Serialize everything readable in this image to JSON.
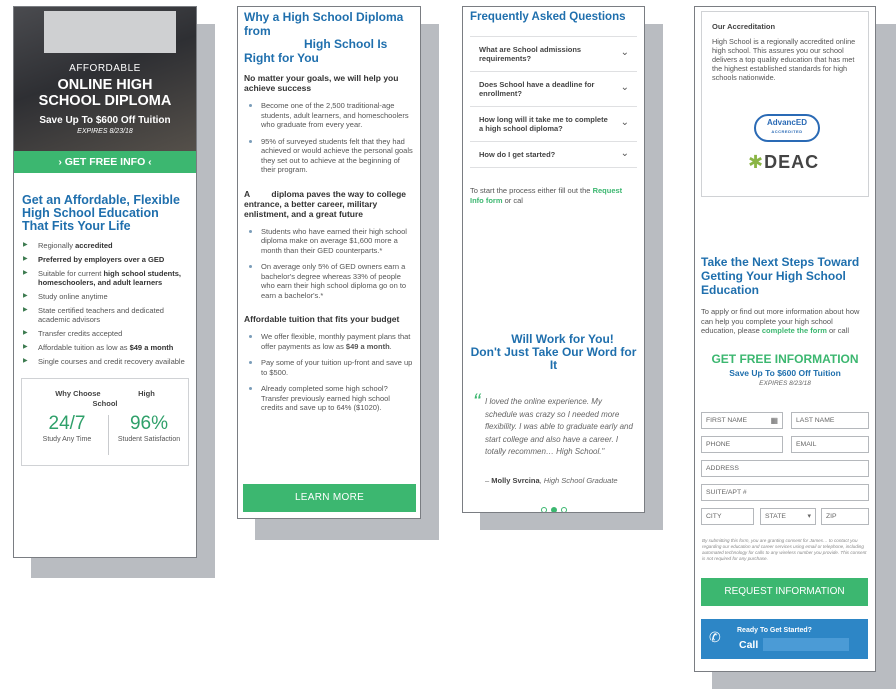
{
  "panel1": {
    "kicker": "AFFORDABLE",
    "headline_1": "ONLINE HIGH",
    "headline_2": "SCHOOL DIPLOMA",
    "offer": "Save Up To $600 Off Tuition",
    "expires": "EXPIRES 8/23/18",
    "cta": "› GET FREE INFO ‹",
    "title": "Get an Affordable, Flexible High School Education That Fits Your Life",
    "benefits": [
      {
        "pre": "Regionally ",
        "bold": "accredited",
        "post": ""
      },
      {
        "pre": "",
        "bold": "Preferred by employers over a GED",
        "post": ""
      },
      {
        "pre": "Suitable for current ",
        "bold": "high school students, homeschoolers, and adult learners",
        "post": ""
      },
      {
        "pre": "Study online anytime",
        "bold": "",
        "post": ""
      },
      {
        "pre": "State certified teachers and dedicated academic advisors",
        "bold": "",
        "post": ""
      },
      {
        "pre": "Transfer credits accepted",
        "bold": "",
        "post": ""
      },
      {
        "pre": "Affordable tuition as low as ",
        "bold": "$49 a month",
        "post": ""
      },
      {
        "pre": "Single courses and credit recovery available",
        "bold": "",
        "post": ""
      }
    ],
    "why_title_1": "Why Choose",
    "why_title_2": "High",
    "why_title_3": "School",
    "stats": [
      {
        "num": "24/7",
        "label": "Study Any Time"
      },
      {
        "num": "96%",
        "label": "Student Satisfaction"
      }
    ]
  },
  "panel2": {
    "title_1": "Why a High School Diploma from",
    "title_2": "High School Is",
    "title_3": "Right for You",
    "h1": "No matter your goals, we will help you achieve success",
    "list1": [
      "Become one of the 2,500 traditional-age students, adult learners, and homeschoolers who graduate from every year.",
      "95% of surveyed students felt that they had achieved or would achieve the personal goals they set out to achieve at the beginning of their program."
    ],
    "h2_a": "A",
    "h2_b": "diploma paves the way to college entrance, a better career, military enlistment, and a great future",
    "list2": [
      "Students who have earned their high school diploma make on average $1,600 more a month than their GED counterparts.*",
      "On average only 5% of GED owners earn a bachelor's degree whereas 33% of people who earn their high school diploma go on to earn a bachelor's.*"
    ],
    "h3": "Affordable tuition that fits your budget",
    "list3_0_pre": "We offer flexible, monthly payment plans that offer payments as low as ",
    "list3_0_bold": "$49 a month",
    "list3_0_post": ".",
    "list3": [
      "Pay some of your tuition up-front and save up to $500.",
      "Already completed some high school? Transfer previously earned high school credits and save up to 64% ($1020)."
    ],
    "cta": "LEARN MORE"
  },
  "panel3": {
    "title": "Frequently Asked Questions",
    "faqs": [
      "What are School admissions requirements?",
      "Does School have a deadline for enrollment?",
      "How long will it take me to complete a high school diploma?",
      "How do I get started?"
    ],
    "start_pre": "To start the process either fill out the ",
    "start_link": "Request Info form",
    "start_post": " or cal",
    "quote_title_1": "Will Work for You!",
    "quote_title_2": "Don't Just Take Our Word for It",
    "quote": "I loved the online experience. My schedule was crazy so I needed more flexibility. I was able to graduate early and start college and also have a career. I totally recommen… High School.\"",
    "quote_author": "Molly Svrcina",
    "quote_author_role": ", High School Graduate"
  },
  "panel4": {
    "accred_title": "Our Accreditation",
    "accred_text": "High School is a regionally accredited online high school. This assures you our school delivers a top quality education that has met the highest established standards for high schools nationwide.",
    "logo_advanced": "AdvancED",
    "logo_advanced_sub": "ACCREDITED",
    "logo_deac": "DEAC",
    "title": "Take the Next Steps Toward Getting Your High School Education",
    "apply_pre": "To apply or find out more information about how can help you complete your high school education, please ",
    "apply_link": "complete the form",
    "apply_post": " or call",
    "form_title": "GET FREE INFORMATION",
    "form_offer": "Save Up To $600 Off Tuition",
    "form_expires": "EXPIRES 8/23/18",
    "fields": {
      "first_name": "FIRST NAME",
      "last_name": "LAST NAME",
      "phone": "PHONE",
      "email": "EMAIL",
      "address": "ADDRESS",
      "suite": "SUITE/APT #",
      "city": "CITY",
      "state": "STATE",
      "zip": "ZIP"
    },
    "consent": "By submitting this form, you are granting consent for James… to contact you regarding our education and career services using email or telephone, including automated technology for calls to any wireless number you provide. This consent is not required for any purchase.",
    "submit": "REQUEST INFORMATION",
    "call_l1": "Ready To Get Started?",
    "call_l2": "Call"
  }
}
